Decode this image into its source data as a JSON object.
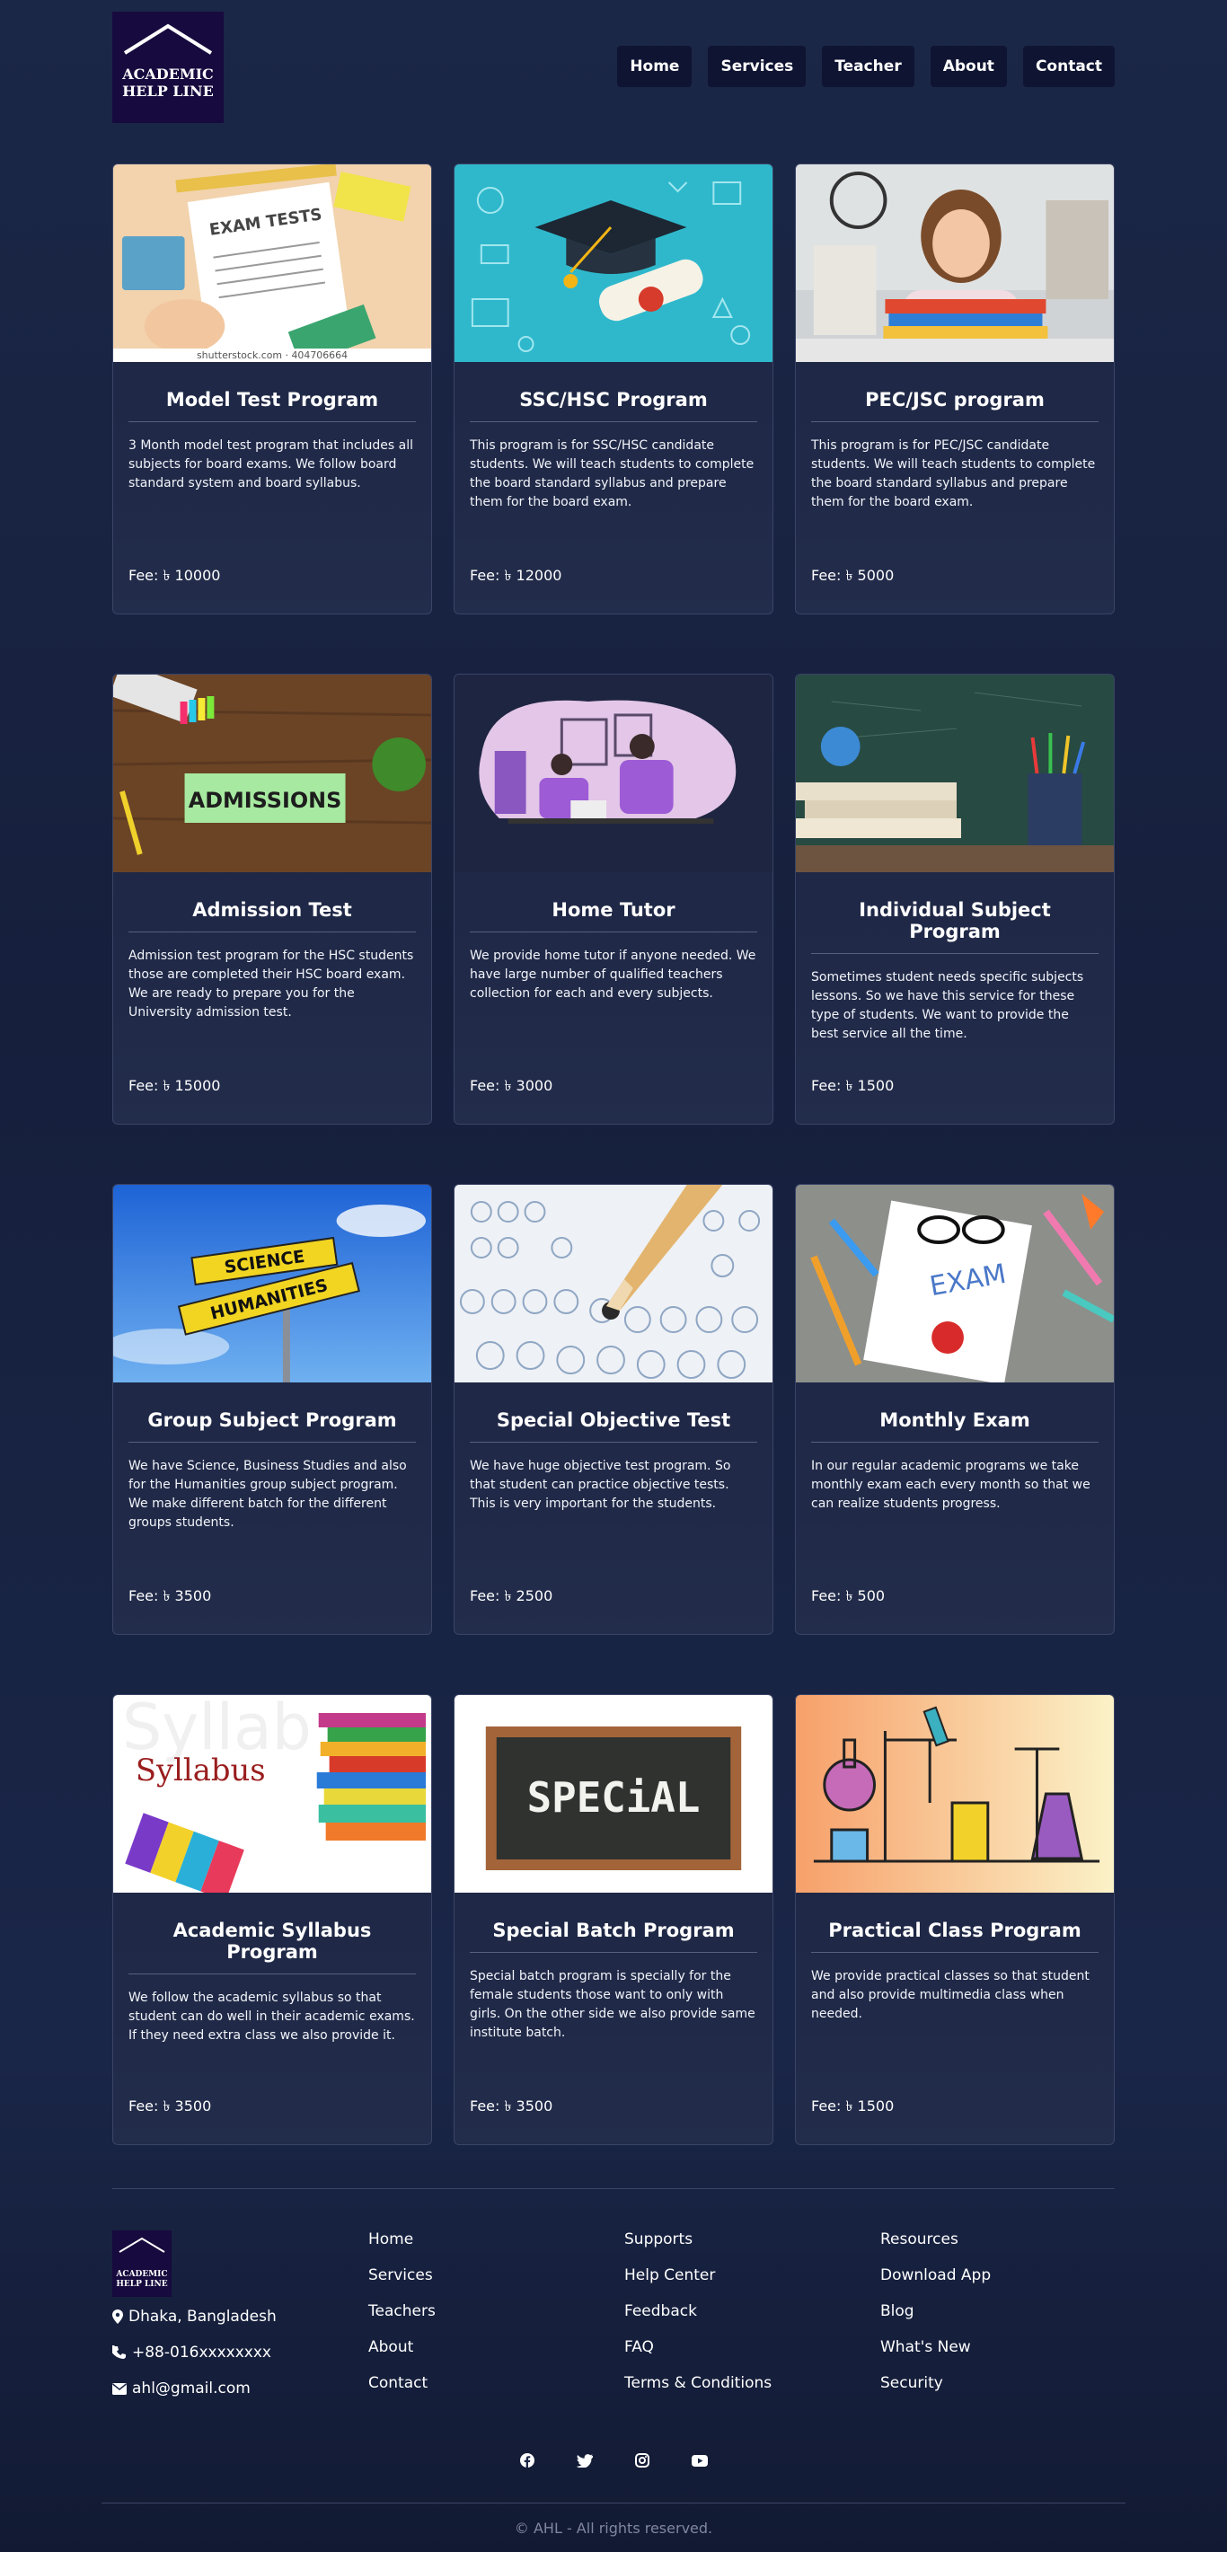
{
  "brand": {
    "line1": "ACADEMIC",
    "line2": "HELP LINE"
  },
  "nav": [
    "Home",
    "Services",
    "Teacher",
    "About",
    "Contact"
  ],
  "cards": [
    {
      "title": "Model Test Program",
      "desc": "3 Month model test program that includes all subjects for board exams. We follow board standard system and board syllabus.",
      "fee": "Fee: ৳ 10000",
      "image": "exam-tests-illustration",
      "image_text": "EXAM TESTS",
      "image_caption": "shutterstock.com · 404706664"
    },
    {
      "title": "SSC/HSC Program",
      "desc": "This program is for SSC/HSC candidate students. We will teach students to complete the board standard syllabus and prepare them for the board exam.",
      "fee": "Fee: ৳ 12000",
      "image": "graduation-cap-illustration"
    },
    {
      "title": "PEC/JSC program",
      "desc": "This program is for PEC/JSC candidate students. We will teach students to complete the board standard syllabus and prepare them for the board exam.",
      "fee": "Fee: ৳ 5000",
      "image": "smiling-girl-photo"
    },
    {
      "title": "Admission Test",
      "desc": "Admission test program for the HSC students those are completed their HSC board exam. We are ready to prepare you for the University admission test.",
      "fee": "Fee: ৳ 15000",
      "image": "admissions-desk-photo",
      "image_text": "ADMISSIONS"
    },
    {
      "title": "Home Tutor",
      "desc": "We provide home tutor if anyone needed. We have large number of qualified teachers collection for each and every subjects.",
      "fee": "Fee: ৳ 3000",
      "image": "home-tutor-illustration"
    },
    {
      "title": "Individual Subject Program",
      "desc": "Sometimes student needs specific subjects lessons. So we have this service for these type of students. We want to provide the best service all the time.",
      "fee": "Fee: ৳ 1500",
      "image": "books-globe-photo"
    },
    {
      "title": "Group Subject Program",
      "desc": "We have Science, Business Studies and also for the Humanities group subject program. We make different batch for the different groups students.",
      "fee": "Fee: ৳ 3500",
      "image": "science-humanities-sign",
      "image_text": "SCIENCE",
      "image_text2": "HUMANITIES"
    },
    {
      "title": "Special Objective Test",
      "desc": "We have huge objective test program. So that student can practice objective tests. This is very important for the students.",
      "fee": "Fee: ৳ 2500",
      "image": "answer-sheet-pencil-photo"
    },
    {
      "title": "Monthly Exam",
      "desc": "In our regular academic programs we take monthly exam each every month so that we can realize students progress.",
      "fee": "Fee: ৳ 500",
      "image": "exam-notebook-photo",
      "image_text": "EXAM"
    },
    {
      "title": "Academic Syllabus Program",
      "desc": "We follow the academic syllabus so that student can do well in their academic exams. If they need extra class we also provide it.",
      "fee": "Fee: ৳ 3500",
      "image": "syllabus-books-photo",
      "image_text": "Syllabus"
    },
    {
      "title": "Special Batch Program",
      "desc": "Special batch program is specially for the female students those want to only with girls. On the other side we also provide same institute batch.",
      "fee": "Fee: ৳ 3500",
      "image": "special-chalkboard",
      "image_text": "SPECiAL"
    },
    {
      "title": "Practical Class Program",
      "desc": "We provide practical classes so that student and also provide multimedia class when needed.",
      "fee": "Fee: ৳ 1500",
      "image": "chemistry-lab-illustration"
    }
  ],
  "footer": {
    "contact": {
      "address": "Dhaka, Bangladesh",
      "phone": "+88-016xxxxxxxx",
      "email": "ahl@gmail.com"
    },
    "col2": [
      "Home",
      "Services",
      "Teachers",
      "About",
      "Contact"
    ],
    "col3": [
      "Supports",
      "Help Center",
      "Feedback",
      "FAQ",
      "Terms & Conditions"
    ],
    "col4": [
      "Resources",
      "Download App",
      "Blog",
      "What's New",
      "Security"
    ],
    "social_icons": [
      "facebook-icon",
      "twitter-icon",
      "instagram-icon",
      "youtube-icon"
    ],
    "copyright": "© AHL - All rights reserved."
  },
  "colors": {
    "page_bg": "#1b2747",
    "logo_bg": "#170a3e",
    "nav_bg": "#0f1432",
    "card_border": "#3a4466"
  }
}
